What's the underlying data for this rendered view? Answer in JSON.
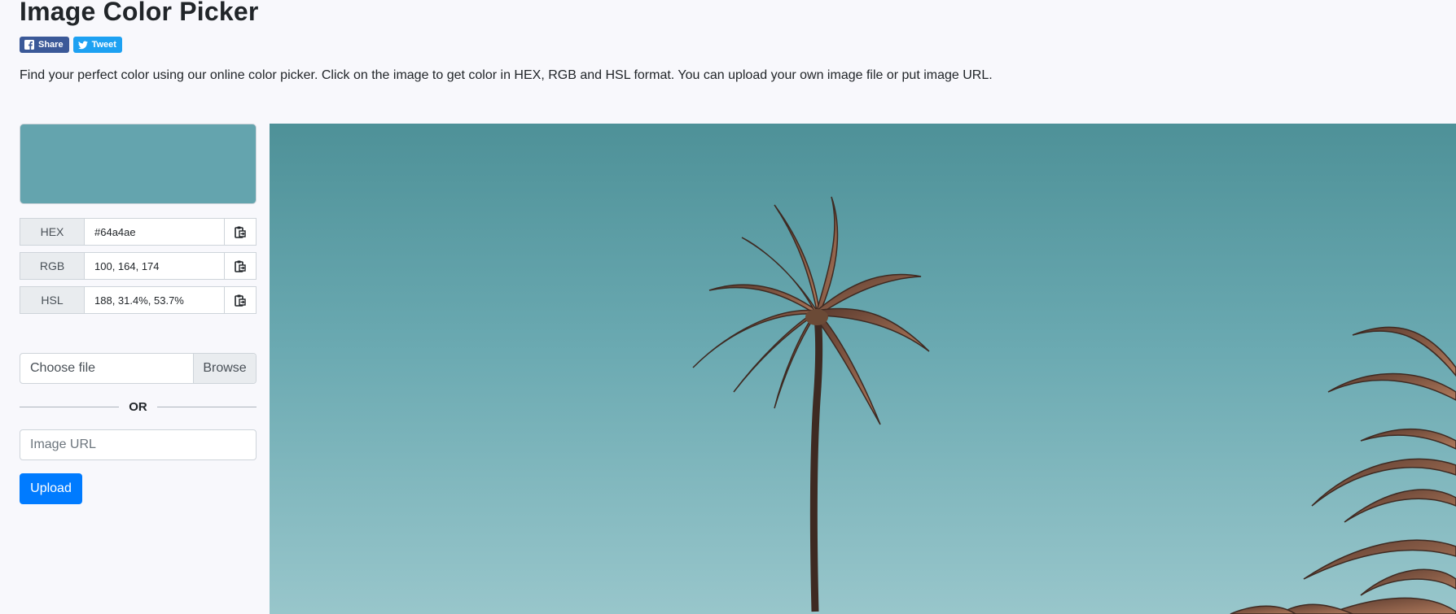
{
  "header": {
    "title": "Image Color Picker",
    "share_label": "Share",
    "tweet_label": "Tweet",
    "intro": "Find your perfect color using our online color picker. Click on the image to get color in HEX, RGB and HSL format. You can upload your own image file or put image URL."
  },
  "picker": {
    "swatch_color": "#64a4ae",
    "rows": [
      {
        "label": "HEX",
        "value": "#64a4ae"
      },
      {
        "label": "RGB",
        "value": "100, 164, 174"
      },
      {
        "label": "HSL",
        "value": "188, 31.4%, 53.7%"
      }
    ]
  },
  "upload": {
    "file_placeholder": "Choose file",
    "browse_label": "Browse",
    "or_label": "OR",
    "url_placeholder": "Image URL",
    "upload_label": "Upload"
  },
  "colors": {
    "brand_blue": "#007bff",
    "facebook": "#3b5998",
    "twitter": "#1da1f2",
    "sky_top": "#4e9198",
    "sky_bottom": "#98c6cb",
    "palm_trunk": "#3e2a22",
    "palm_frond": "#8a5a44"
  },
  "icons": {
    "share": "facebook-icon",
    "tweet": "twitter-icon",
    "copy": "clipboard-icon"
  }
}
